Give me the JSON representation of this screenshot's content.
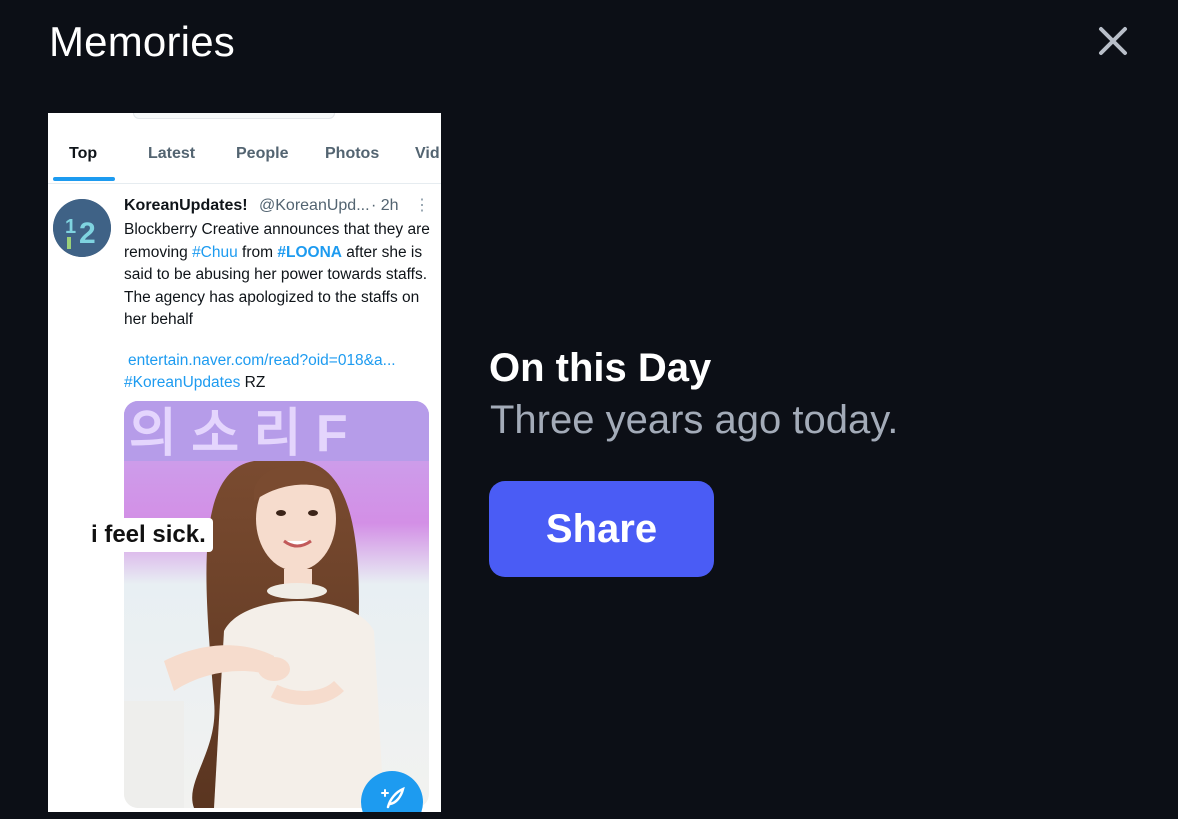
{
  "header": {
    "title": "Memories",
    "close_icon": "close-icon"
  },
  "memory_card": {
    "tabs": [
      {
        "label": "Top",
        "active": true
      },
      {
        "label": "Latest",
        "active": false
      },
      {
        "label": "People",
        "active": false
      },
      {
        "label": "Photos",
        "active": false
      },
      {
        "label": "Vid",
        "active": false
      }
    ],
    "tweet": {
      "name": "KoreanUpdates!",
      "handle": "@KoreanUpd...",
      "time": "· 2h",
      "body_1": "Blockberry Creative announces that they are removing ",
      "hashtag_1": "#Chuu",
      "body_2": " from ",
      "hashtag_2": "#LOONA",
      "body_3": " after she is said to be abusing her power towards staffs. The agency has apologized to the staffs on her behalf",
      "link": "entertain.naver.com/read?oid=018&a...",
      "hashtag_3": "#KoreanUpdates",
      "tagline_suffix": " RZ",
      "image_caption": "i feel sick."
    },
    "accent_color": "#1d9bf0"
  },
  "memory": {
    "title": "On this Day",
    "subtitle": "Three years ago today.",
    "share_label": "Share",
    "share_color": "#4a5cf5"
  }
}
